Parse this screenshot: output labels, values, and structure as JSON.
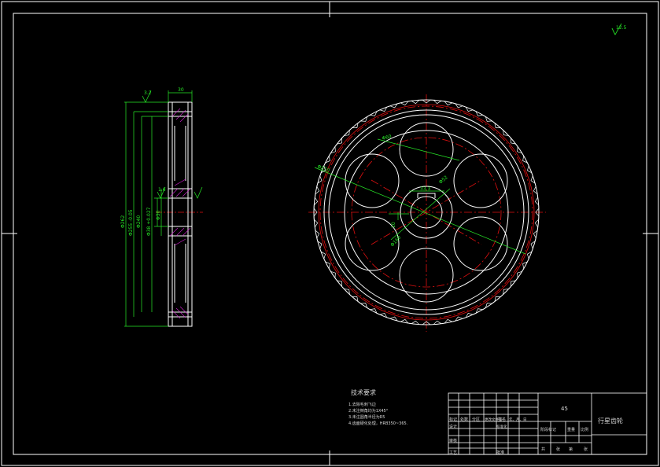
{
  "colors": {
    "background": "#000000",
    "outline": "#ffffff",
    "centerline": "#e01010",
    "dimension": "#27e827",
    "hatch": "#d020d0",
    "text": "#d8d8d8"
  },
  "tech_requirements": {
    "title": "技术要求",
    "items": [
      "1.去除毛刺飞边",
      "2.未注倒角均为1X45°",
      "3.未注圆角半径为R5",
      "4.齿面硬化处理，HRB350~365."
    ]
  },
  "title_block": {
    "material": "45",
    "part_name": "行星齿轮",
    "row_labels": [
      "标记",
      "处数",
      "分区",
      "更改文件号",
      "签名",
      "年、月、日"
    ],
    "design_label": "设计",
    "standardize_label": "标准化",
    "review_label": "审核",
    "process_label": "工艺",
    "approve_label": "批准",
    "stage_label": "阶段标记",
    "weight_label": "重量",
    "scale_label": "比例",
    "sheet_total": "共",
    "sheet_label": "张",
    "sheet_no": "第",
    "sheet_label2": "张"
  },
  "side_view_dims": {
    "face_width": "30",
    "tip_diameter": "Φ262",
    "pitch_diameter": "Φ255 -0.05",
    "root_diameter": "Φ240",
    "hub_diameter": "Φ38 +0.027",
    "bore": "Φ30",
    "roughness_top": "3.2",
    "roughness_mid": "1.6",
    "roughness_corner": "12.5"
  },
  "front_view_dims": {
    "hole_diameter": "Φ60",
    "outer_dim": "Φ250",
    "pcd_dim": "Φ160",
    "hub_dim": "Φ40",
    "keyway": "10",
    "center_dim": "Φ52",
    "keyway_depth": "33.3"
  }
}
